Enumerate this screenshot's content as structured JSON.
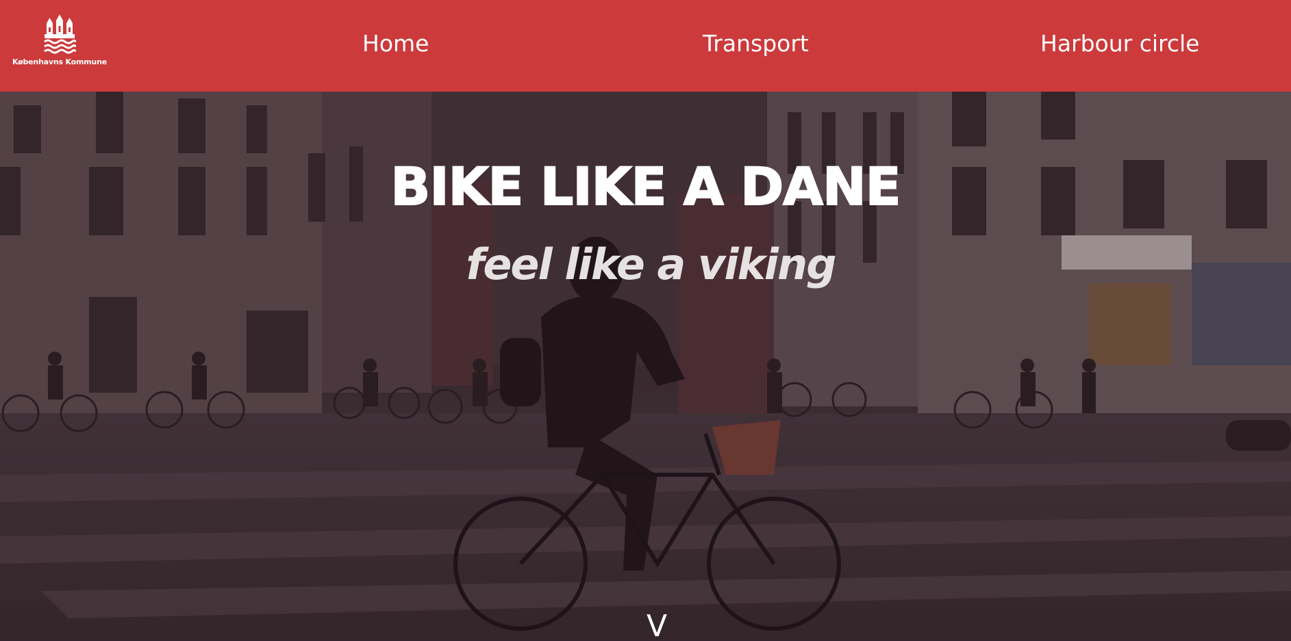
{
  "header": {
    "logo_text": "Københavns Kommune",
    "logo_icon": "copenhagen-castle-crest-icon",
    "nav": [
      {
        "label": "Home"
      },
      {
        "label": "Transport"
      },
      {
        "label": "Harbour circle"
      }
    ],
    "background_color": "#cc3a3b"
  },
  "hero": {
    "title": "BIKE LIKE A DANE",
    "subtitle": "feel like a viking",
    "scroll_indicator": "V",
    "image_description_icon": "cyclist-street-photo"
  }
}
